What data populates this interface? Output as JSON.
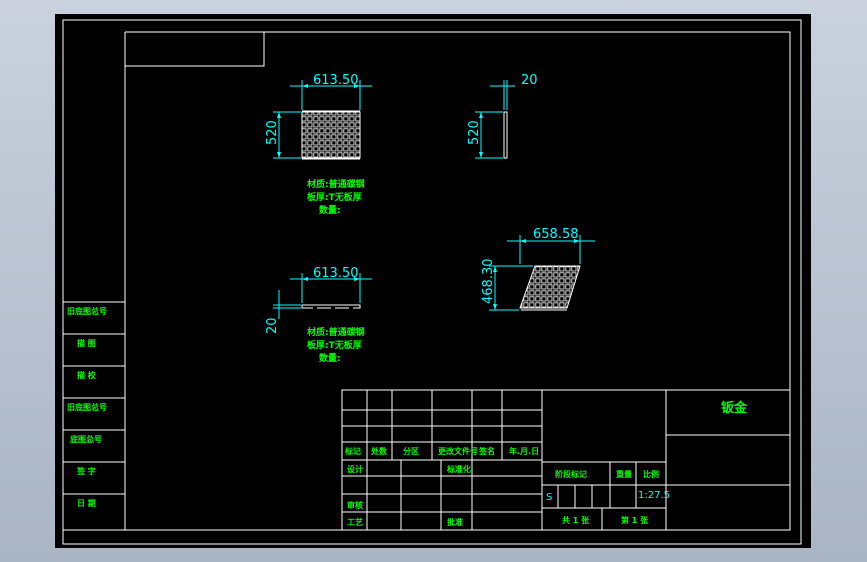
{
  "drawing": {
    "colors": {
      "background": "#000000",
      "line": "#ffffff",
      "dimension": "#00ffff",
      "text": "#00ff00"
    },
    "views": {
      "front": {
        "width_label": "613.50",
        "height_label": "520"
      },
      "side": {
        "width_label": "20",
        "height_label": "520"
      },
      "top": {
        "width_label": "613.50",
        "height_label": "20"
      },
      "iso": {
        "width_label": "658.58",
        "height_label": "468.30"
      }
    },
    "notes": {
      "upper": {
        "line1": "材质:普通碳钢",
        "line2": "板厚:T无板厚",
        "line3": "数量:"
      },
      "lower": {
        "line1": "材质:普通碳钢",
        "line2": "板厚:T无板厚",
        "line3": "数量:"
      }
    },
    "left_strip": [
      "旧底图总号",
      "描 图",
      "描 校",
      "旧底图总号",
      "底图总号",
      "签 字",
      "日 期"
    ],
    "title_block": {
      "headers": [
        "标记",
        "处数",
        "分区",
        "更改文件号",
        "签名",
        "年.月.日"
      ],
      "design": "设计",
      "standardize": "标准化",
      "review": "审核",
      "process": "工艺",
      "approve": "批准",
      "stage_mark": "阶段标记",
      "weight": "重量",
      "scale": "比例",
      "stage_value": "S",
      "scale_value": "1:27.5",
      "sheets_total": "共 1 张",
      "sheet_no": "第 1 张",
      "part_name": "钣金"
    }
  }
}
